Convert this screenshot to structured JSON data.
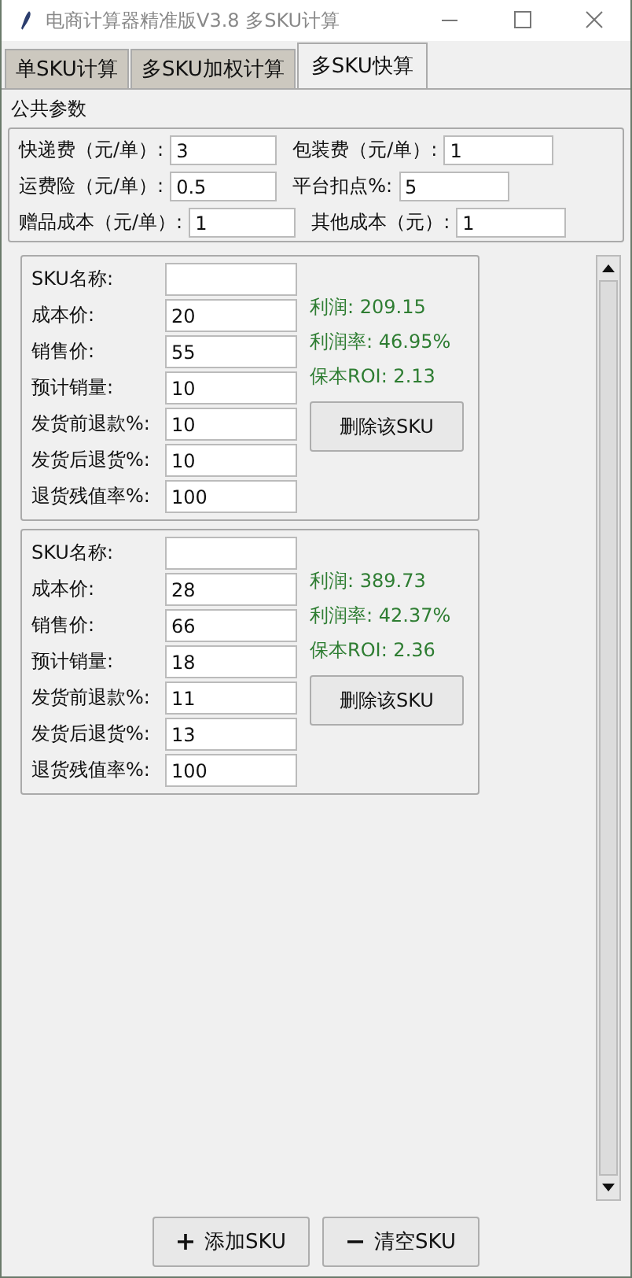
{
  "window": {
    "title": "电商计算器精准版V3.8 多SKU计算"
  },
  "tabs": [
    {
      "label": "单SKU计算",
      "selected": false
    },
    {
      "label": "多SKU加权计算",
      "selected": false
    },
    {
      "label": "多SKU快算",
      "selected": true
    }
  ],
  "common_params": {
    "title": "公共参数",
    "rows": [
      [
        {
          "label": "快递费（元/单）:",
          "value": "3"
        },
        {
          "label": "包装费（元/单）:",
          "value": "1"
        }
      ],
      [
        {
          "label": "运费险（元/单）:",
          "value": "0.5"
        },
        {
          "label": "平台扣点%:",
          "value": "5"
        }
      ],
      [
        {
          "label": "赠品成本（元/单）:",
          "value": "1"
        },
        {
          "label": "其他成本（元）:",
          "value": "1"
        }
      ]
    ]
  },
  "skus": [
    {
      "fields": [
        {
          "label": "SKU名称:"
        },
        {
          "label": "成本价:",
          "value": "20"
        },
        {
          "label": "销售价:",
          "value": "55"
        },
        {
          "label": "预计销量:",
          "value": "10"
        },
        {
          "label": "发货前退款%:",
          "value": "10"
        },
        {
          "label": "发货后退货%:",
          "value": "10"
        },
        {
          "label": "退货残值率%:",
          "value": "100"
        }
      ],
      "results": [
        "利润: 209.15",
        "利润率: 46.95%",
        "保本ROI: 2.13"
      ],
      "delete_button": "删除该SKU"
    },
    {
      "fields": [
        {
          "label": "SKU名称:"
        },
        {
          "label": "成本价:",
          "value": "28"
        },
        {
          "label": "销售价:",
          "value": "66"
        },
        {
          "label": "预计销量:",
          "value": "18"
        },
        {
          "label": "发货前退款%:",
          "value": "11"
        },
        {
          "label": "发货后退货%:",
          "value": "13"
        },
        {
          "label": "退货残值率%:",
          "value": "100"
        }
      ],
      "results": [
        "利润: 389.73",
        "利润率: 42.37%",
        "保本ROI: 2.36"
      ],
      "delete_button": "删除该SKU"
    }
  ],
  "buttons": [
    {
      "kind": "add",
      "label": "添加SKU"
    },
    {
      "kind": "clear",
      "label": "清空SKU"
    }
  ]
}
